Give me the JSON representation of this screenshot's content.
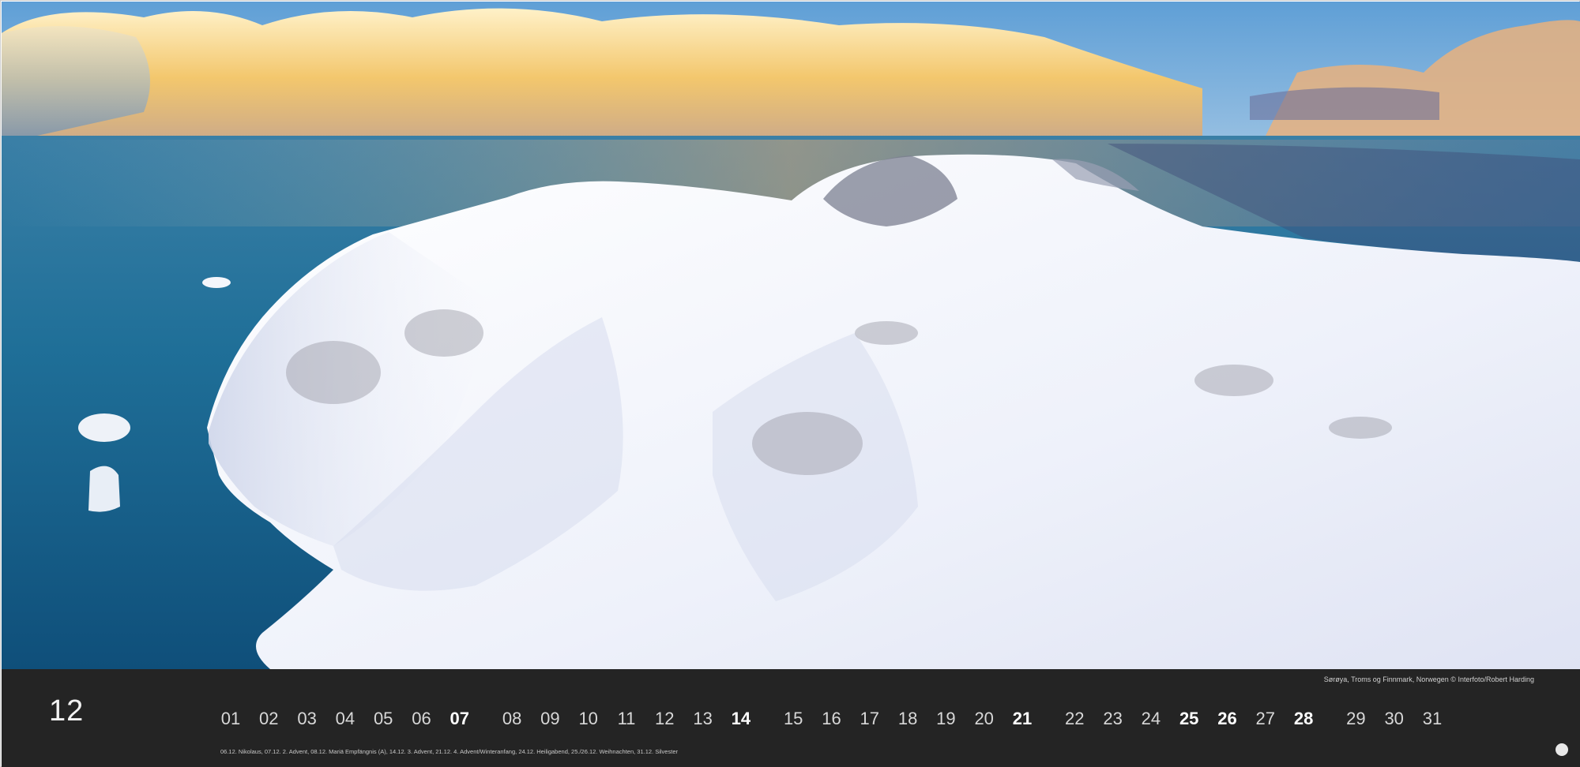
{
  "calendar": {
    "month": "12",
    "photo_credit": "Sørøya, Troms og Finnmark, Norwegen © Interfoto/Robert Harding",
    "days": [
      {
        "label": "01",
        "bold": false
      },
      {
        "label": "02",
        "bold": false
      },
      {
        "label": "03",
        "bold": false
      },
      {
        "label": "04",
        "bold": false
      },
      {
        "label": "05",
        "bold": false
      },
      {
        "label": "06",
        "bold": false
      },
      {
        "label": "07",
        "bold": true
      },
      {
        "label": "08",
        "bold": false
      },
      {
        "label": "09",
        "bold": false
      },
      {
        "label": "10",
        "bold": false
      },
      {
        "label": "11",
        "bold": false
      },
      {
        "label": "12",
        "bold": false
      },
      {
        "label": "13",
        "bold": false
      },
      {
        "label": "14",
        "bold": true
      },
      {
        "label": "15",
        "bold": false
      },
      {
        "label": "16",
        "bold": false
      },
      {
        "label": "17",
        "bold": false
      },
      {
        "label": "18",
        "bold": false
      },
      {
        "label": "19",
        "bold": false
      },
      {
        "label": "20",
        "bold": false
      },
      {
        "label": "21",
        "bold": true
      },
      {
        "label": "22",
        "bold": false
      },
      {
        "label": "23",
        "bold": false
      },
      {
        "label": "24",
        "bold": false
      },
      {
        "label": "25",
        "bold": true
      },
      {
        "label": "26",
        "bold": true
      },
      {
        "label": "27",
        "bold": false
      },
      {
        "label": "28",
        "bold": true
      },
      {
        "label": "29",
        "bold": false
      },
      {
        "label": "30",
        "bold": false
      },
      {
        "label": "31",
        "bold": false
      }
    ],
    "holidays_note": "06.12. Nikolaus, 07.12. 2. Advent, 08.12. Mariä Empfängnis (A), 14.12. 3. Advent, 21.12. 4. Advent/Winteranfang, 24.12. Heiligabend, 25./26.12. Weihnachten, 31.12. Silvester"
  },
  "colors": {
    "bar_background": "#242424",
    "sea": "#1e6e96",
    "snow": "#f3f5fb",
    "cloud_gold": "#f2c46a"
  }
}
